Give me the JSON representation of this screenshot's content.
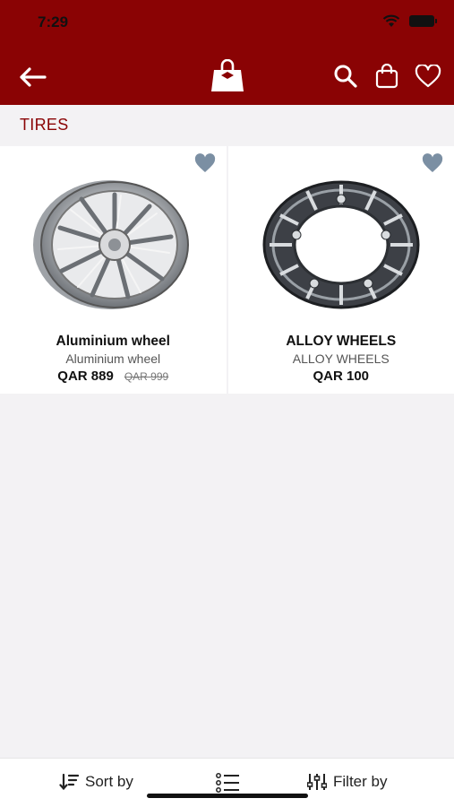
{
  "status_bar": {
    "time": "7:29"
  },
  "header": {
    "back_icon": "arrow-left-icon",
    "logo_icon": "shopping-bag-logo",
    "actions": [
      "search-icon",
      "bag-icon",
      "heart-icon"
    ]
  },
  "category": {
    "title": "TIRES"
  },
  "products": [
    {
      "name": "Aluminium wheel",
      "subtitle": "Aluminium wheel",
      "price": "QAR 889",
      "old_price": "QAR 999"
    },
    {
      "name": "ALLOY WHEELS",
      "subtitle": "ALLOY WHEELS",
      "price": "QAR 100",
      "old_price": ""
    }
  ],
  "bottom_bar": {
    "sort_label": "Sort by",
    "filter_label": "Filter by"
  },
  "colors": {
    "brand": "#8a0304",
    "background": "#f3f2f4",
    "favorite": "#7b8fa3"
  }
}
